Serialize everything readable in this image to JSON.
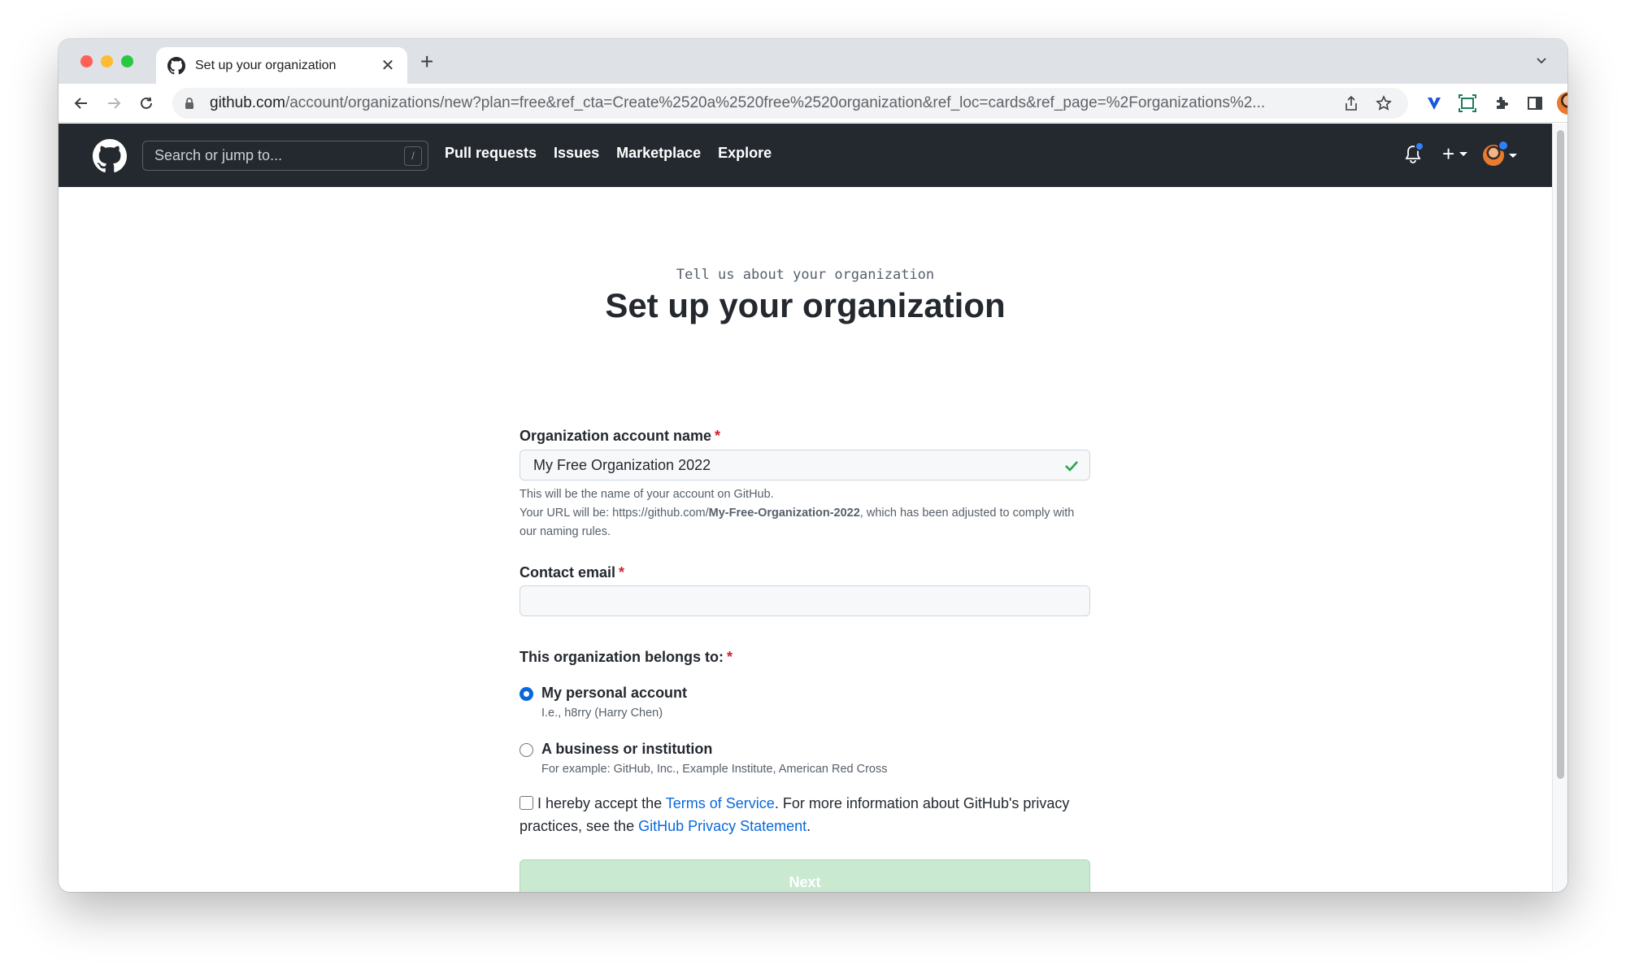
{
  "browser": {
    "tab_title": "Set up your organization",
    "url_host": "github.com",
    "url_path": "/account/organizations/new?plan=free&ref_cta=Create%2520a%2520free%2520organization&ref_loc=cards&ref_page=%2Forganizations%2..."
  },
  "header": {
    "search_placeholder": "Search or jump to...",
    "search_shortcut": "/",
    "nav": [
      "Pull requests",
      "Issues",
      "Marketplace",
      "Explore"
    ],
    "new_label": "+"
  },
  "page": {
    "eyebrow": "Tell us about your organization",
    "title": "Set up your organization"
  },
  "form": {
    "org_name_label": "Organization account name",
    "required_mark": "*",
    "org_name_value": "My Free Organization 2022",
    "org_note_1": "This will be the name of your account on GitHub.",
    "org_note_2_prefix": "Your URL will be: https://github.com/",
    "org_note_2_slug": "My-Free-Organization-2022",
    "org_note_2_suffix": ", which has been adjusted to comply with our naming rules.",
    "email_label": "Contact email",
    "email_value": "",
    "belongs_label": "This organization belongs to:",
    "option_personal": "My personal account",
    "option_personal_sub": "I.e., h8rry (Harry Chen)",
    "option_business": "A business or institution",
    "option_business_sub": "For example: GitHub, Inc., Example Institute, American Red Cross",
    "selected_option": "personal",
    "tos_prefix": "I hereby accept the ",
    "tos_link": "Terms of Service",
    "tos_middle": ". For more information about GitHub's privacy practices, see the ",
    "privacy_link": "GitHub Privacy Statement",
    "tos_suffix": ".",
    "tos_checked": false,
    "next_label": "Next"
  },
  "colors": {
    "header_bg": "#24292f",
    "link": "#0969da",
    "success": "#2da44e",
    "next_disabled": "#c9e9d1"
  }
}
